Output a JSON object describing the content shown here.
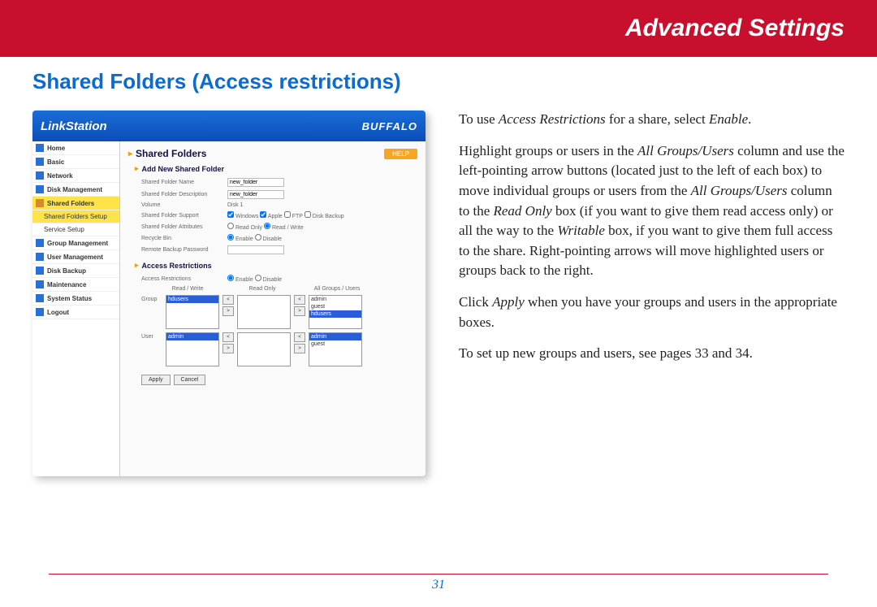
{
  "header": {
    "title": "Advanced Settings"
  },
  "section_title": "Shared Folders (Access restrictions)",
  "page_number": "31",
  "instructions": {
    "p1_a": "To use ",
    "p1_b": "Access Restrictions",
    "p1_c": " for a share, select ",
    "p1_d": "Enable",
    "p1_e": ".",
    "p2_a": "Highlight groups or users in the ",
    "p2_b": "All Groups/Users",
    "p2_c": " column and use the left-pointing arrow buttons (located just to the left of each box) to move individual groups or users from the ",
    "p2_d": "All Groups/Users",
    "p2_e": " column to the ",
    "p2_f": "Read Only",
    "p2_g": " box (if you want to give them read access only) or all the way to the ",
    "p2_h": "Writable",
    "p2_i": " box, if you want to give them full access to the share.  Right-pointing arrows will move highlighted users or groups back to the right.",
    "p3_a": "Click ",
    "p3_b": "Apply",
    "p3_c": " when you have your groups and users in the appropriate boxes.",
    "p4": "To set up new groups and users, see pages 33 and 34."
  },
  "app": {
    "logo": "LinkStation",
    "brand": "BUFFALO",
    "help": "HELP",
    "nav": [
      "Home",
      "Basic",
      "Network",
      "Disk Management",
      "Shared Folders",
      "Shared Folders Setup",
      "Service Setup",
      "Group Management",
      "User Management",
      "Disk Backup",
      "Maintenance",
      "System Status",
      "Logout"
    ],
    "panel_title": "Shared Folders",
    "sub1": "Add New Shared Folder",
    "fields": {
      "name_lbl": "Shared Folder Name",
      "name_val": "new_folder",
      "desc_lbl": "Shared Folder Description",
      "desc_val": "new_folder",
      "vol_lbl": "Volume",
      "vol_val": "Disk 1",
      "support_lbl": "Shared Folder Support",
      "support_opts": {
        "a": "Windows",
        "b": "Apple",
        "c": "FTP",
        "d": "Disk Backup"
      },
      "attr_lbl": "Shared Folder Attributes",
      "attr_opts": {
        "a": "Read Only",
        "b": "Read / Write"
      },
      "recycle_lbl": "Recycle Bin",
      "recycle_opts": {
        "a": "Enable",
        "b": "Disable"
      },
      "rbp_lbl": "Remote Backup Password"
    },
    "sub2": "Access Restrictions",
    "ar_lbl": "Access Restrictions",
    "ar_opts": {
      "a": "Enable",
      "b": "Disable"
    },
    "cols": {
      "a": "Read / Write",
      "b": "Read Only",
      "c": "All Groups / Users"
    },
    "group_lbl": "Group",
    "user_lbl": "User",
    "group_items": {
      "rw": "hdusers",
      "all_a": "admin",
      "all_b": "guest",
      "all_c": "hdusers"
    },
    "user_items": {
      "rw": "admin",
      "all_a": "admin",
      "all_b": "guest"
    },
    "apply": "Apply",
    "cancel": "Cancel"
  }
}
